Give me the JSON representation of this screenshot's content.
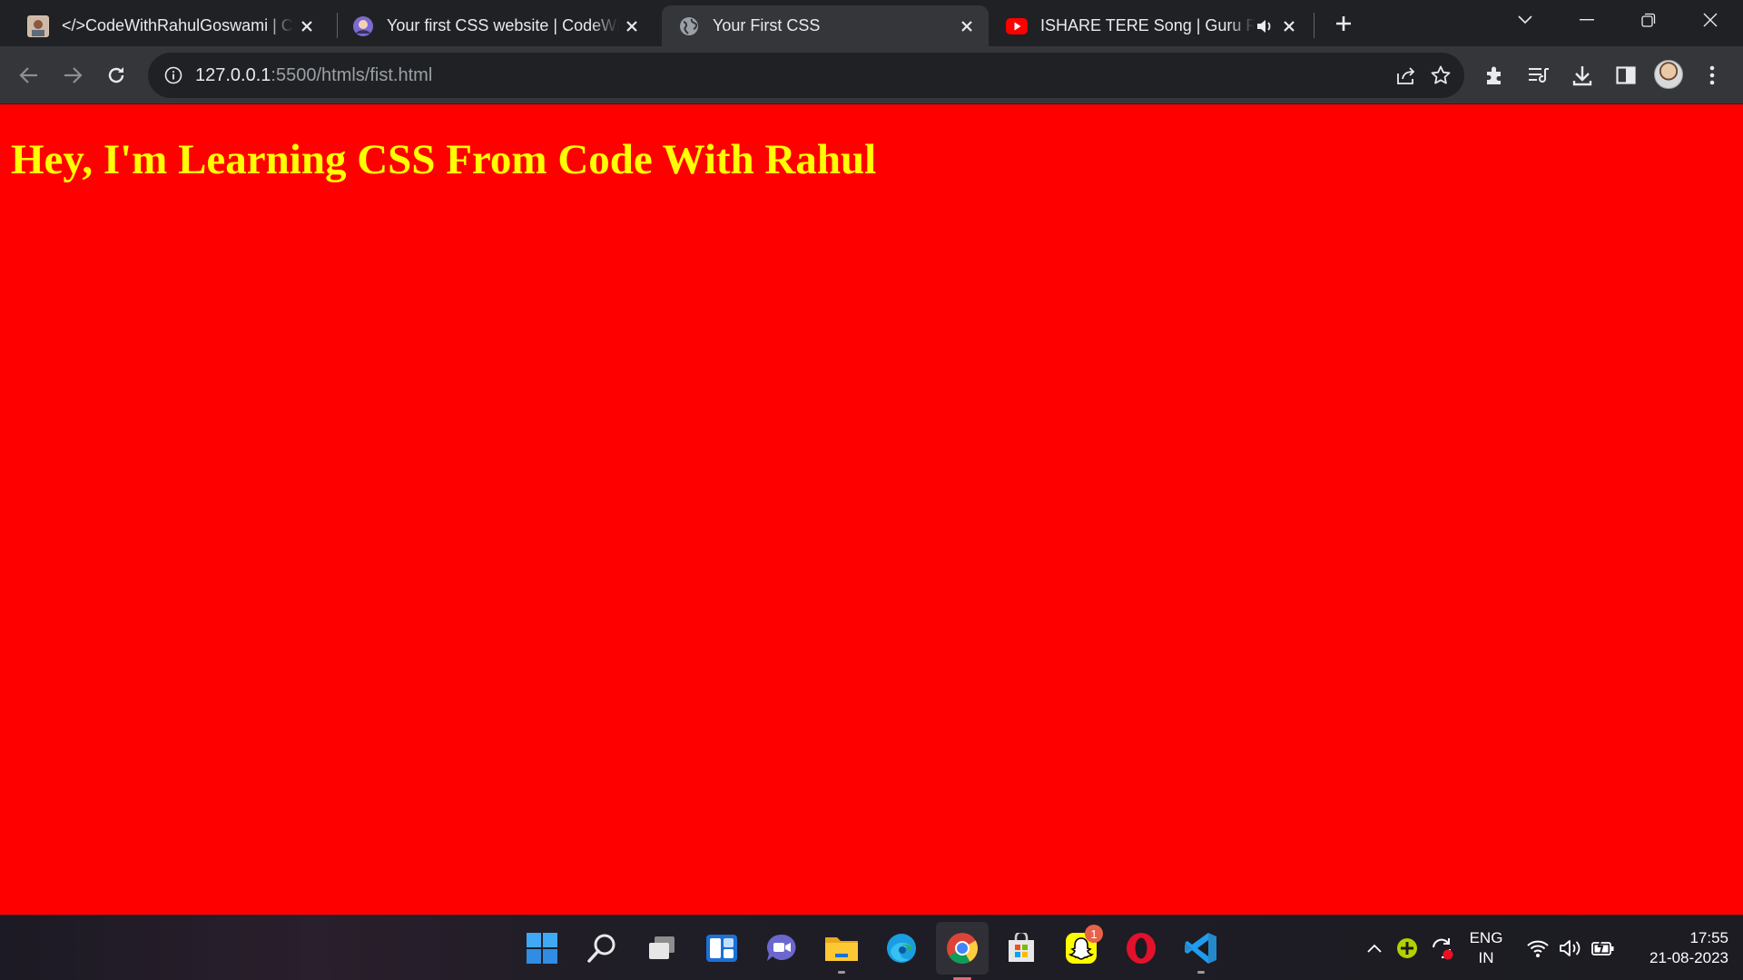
{
  "browser": {
    "tabs": [
      {
        "title": "</>CodeWithRahulGoswami | CSS",
        "favicon": "profile-photo-icon",
        "active": false
      },
      {
        "title": "Your first CSS website | CodeWithHarry",
        "favicon": "avatar-icon",
        "active": false
      },
      {
        "title": "Your First CSS",
        "favicon": "globe-icon",
        "active": true
      },
      {
        "title": "ISHARE TERE Song | Guru Randhawa",
        "favicon": "youtube-icon",
        "active": false,
        "audio": "speaker-icon"
      }
    ],
    "address": {
      "host": "127.0.0.1",
      "path": ":5500/htmls/fist.html"
    }
  },
  "page": {
    "heading": "Hey, I'm Learning CSS From Code With Rahul",
    "background": "#ff0000",
    "heading_color": "#ffff00"
  },
  "taskbar": {
    "apps": [
      "windows-start-icon",
      "search-icon",
      "task-view-icon",
      "widgets-icon",
      "teams-chat-icon",
      "file-explorer-icon",
      "edge-icon",
      "chrome-icon",
      "microsoft-store-icon",
      "snapchat-icon",
      "opera-icon",
      "vscode-icon"
    ],
    "snapchat_badge": "1",
    "language": {
      "line1": "ENG",
      "line2": "IN"
    },
    "clock": {
      "time": "17:55",
      "date": "21-08-2023"
    }
  }
}
